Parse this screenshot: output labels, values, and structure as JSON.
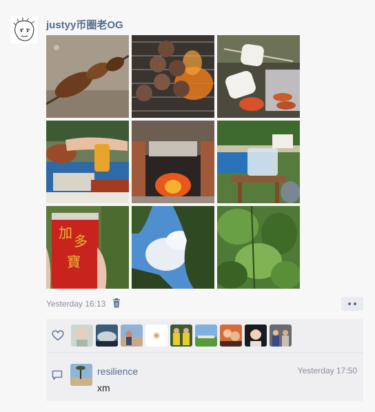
{
  "post": {
    "username": "justyy币圈老OG",
    "photos": [
      "kebab-skewer-photo",
      "burgers-on-grill-photo",
      "marshmallows-photo",
      "picnic-table-food-photo",
      "brick-bbq-fire-photo",
      "outdoor-picnic-photo",
      "red-can-drink-photo",
      "sky-and-trees-photo",
      "green-foliage-photo"
    ],
    "time": "Yesterday 16:13"
  },
  "interaction": {
    "likers_count": 9,
    "comment": {
      "name": "resilience",
      "time": "Yesterday 17:50",
      "text": "xm"
    }
  },
  "colors": {
    "accent": "#556b8f",
    "muted": "#8a8f99",
    "background": "#f7f7f8",
    "panel": "#efeff2"
  },
  "icons": [
    "trash-icon",
    "more-dots-icon",
    "heart-icon",
    "comment-icon"
  ]
}
